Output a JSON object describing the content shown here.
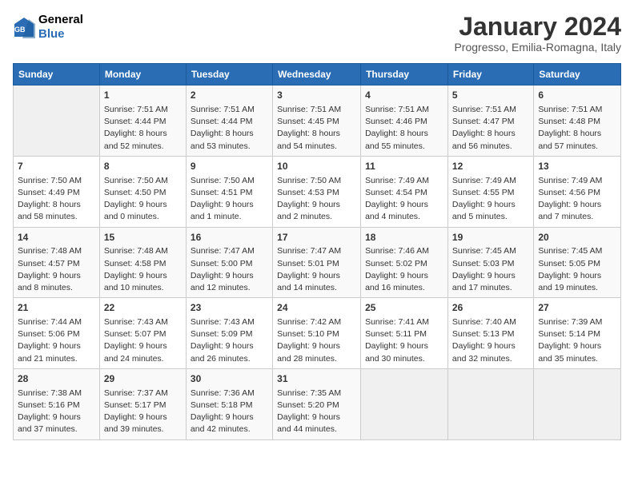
{
  "logo": {
    "line1": "General",
    "line2": "Blue"
  },
  "calendar": {
    "title": "January 2024",
    "subtitle": "Progresso, Emilia-Romagna, Italy"
  },
  "headers": [
    "Sunday",
    "Monday",
    "Tuesday",
    "Wednesday",
    "Thursday",
    "Friday",
    "Saturday"
  ],
  "weeks": [
    [
      {
        "day": "",
        "info": ""
      },
      {
        "day": "1",
        "info": "Sunrise: 7:51 AM\nSunset: 4:44 PM\nDaylight: 8 hours\nand 52 minutes."
      },
      {
        "day": "2",
        "info": "Sunrise: 7:51 AM\nSunset: 4:44 PM\nDaylight: 8 hours\nand 53 minutes."
      },
      {
        "day": "3",
        "info": "Sunrise: 7:51 AM\nSunset: 4:45 PM\nDaylight: 8 hours\nand 54 minutes."
      },
      {
        "day": "4",
        "info": "Sunrise: 7:51 AM\nSunset: 4:46 PM\nDaylight: 8 hours\nand 55 minutes."
      },
      {
        "day": "5",
        "info": "Sunrise: 7:51 AM\nSunset: 4:47 PM\nDaylight: 8 hours\nand 56 minutes."
      },
      {
        "day": "6",
        "info": "Sunrise: 7:51 AM\nSunset: 4:48 PM\nDaylight: 8 hours\nand 57 minutes."
      }
    ],
    [
      {
        "day": "7",
        "info": "Sunrise: 7:50 AM\nSunset: 4:49 PM\nDaylight: 8 hours\nand 58 minutes."
      },
      {
        "day": "8",
        "info": "Sunrise: 7:50 AM\nSunset: 4:50 PM\nDaylight: 9 hours\nand 0 minutes."
      },
      {
        "day": "9",
        "info": "Sunrise: 7:50 AM\nSunset: 4:51 PM\nDaylight: 9 hours\nand 1 minute."
      },
      {
        "day": "10",
        "info": "Sunrise: 7:50 AM\nSunset: 4:53 PM\nDaylight: 9 hours\nand 2 minutes."
      },
      {
        "day": "11",
        "info": "Sunrise: 7:49 AM\nSunset: 4:54 PM\nDaylight: 9 hours\nand 4 minutes."
      },
      {
        "day": "12",
        "info": "Sunrise: 7:49 AM\nSunset: 4:55 PM\nDaylight: 9 hours\nand 5 minutes."
      },
      {
        "day": "13",
        "info": "Sunrise: 7:49 AM\nSunset: 4:56 PM\nDaylight: 9 hours\nand 7 minutes."
      }
    ],
    [
      {
        "day": "14",
        "info": "Sunrise: 7:48 AM\nSunset: 4:57 PM\nDaylight: 9 hours\nand 8 minutes."
      },
      {
        "day": "15",
        "info": "Sunrise: 7:48 AM\nSunset: 4:58 PM\nDaylight: 9 hours\nand 10 minutes."
      },
      {
        "day": "16",
        "info": "Sunrise: 7:47 AM\nSunset: 5:00 PM\nDaylight: 9 hours\nand 12 minutes."
      },
      {
        "day": "17",
        "info": "Sunrise: 7:47 AM\nSunset: 5:01 PM\nDaylight: 9 hours\nand 14 minutes."
      },
      {
        "day": "18",
        "info": "Sunrise: 7:46 AM\nSunset: 5:02 PM\nDaylight: 9 hours\nand 16 minutes."
      },
      {
        "day": "19",
        "info": "Sunrise: 7:45 AM\nSunset: 5:03 PM\nDaylight: 9 hours\nand 17 minutes."
      },
      {
        "day": "20",
        "info": "Sunrise: 7:45 AM\nSunset: 5:05 PM\nDaylight: 9 hours\nand 19 minutes."
      }
    ],
    [
      {
        "day": "21",
        "info": "Sunrise: 7:44 AM\nSunset: 5:06 PM\nDaylight: 9 hours\nand 21 minutes."
      },
      {
        "day": "22",
        "info": "Sunrise: 7:43 AM\nSunset: 5:07 PM\nDaylight: 9 hours\nand 24 minutes."
      },
      {
        "day": "23",
        "info": "Sunrise: 7:43 AM\nSunset: 5:09 PM\nDaylight: 9 hours\nand 26 minutes."
      },
      {
        "day": "24",
        "info": "Sunrise: 7:42 AM\nSunset: 5:10 PM\nDaylight: 9 hours\nand 28 minutes."
      },
      {
        "day": "25",
        "info": "Sunrise: 7:41 AM\nSunset: 5:11 PM\nDaylight: 9 hours\nand 30 minutes."
      },
      {
        "day": "26",
        "info": "Sunrise: 7:40 AM\nSunset: 5:13 PM\nDaylight: 9 hours\nand 32 minutes."
      },
      {
        "day": "27",
        "info": "Sunrise: 7:39 AM\nSunset: 5:14 PM\nDaylight: 9 hours\nand 35 minutes."
      }
    ],
    [
      {
        "day": "28",
        "info": "Sunrise: 7:38 AM\nSunset: 5:16 PM\nDaylight: 9 hours\nand 37 minutes."
      },
      {
        "day": "29",
        "info": "Sunrise: 7:37 AM\nSunset: 5:17 PM\nDaylight: 9 hours\nand 39 minutes."
      },
      {
        "day": "30",
        "info": "Sunrise: 7:36 AM\nSunset: 5:18 PM\nDaylight: 9 hours\nand 42 minutes."
      },
      {
        "day": "31",
        "info": "Sunrise: 7:35 AM\nSunset: 5:20 PM\nDaylight: 9 hours\nand 44 minutes."
      },
      {
        "day": "",
        "info": ""
      },
      {
        "day": "",
        "info": ""
      },
      {
        "day": "",
        "info": ""
      }
    ]
  ]
}
